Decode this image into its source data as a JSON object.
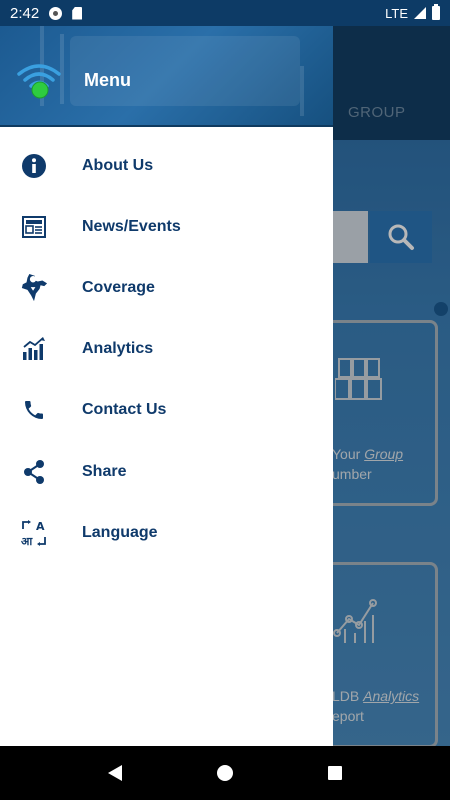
{
  "status_bar": {
    "time": "2:42",
    "network": "LTE",
    "icons": [
      "gear-icon",
      "sd-card-icon",
      "signal-icon",
      "battery-icon"
    ]
  },
  "background": {
    "tab_label": "GROUP",
    "card1_line1_prefix": "Your ",
    "card1_line1_em": "Group",
    "card1_line2": "umber",
    "card2_line1_prefix": "LDB ",
    "card2_line1_em": "Analytics",
    "card2_line2": "eport"
  },
  "drawer": {
    "title": "Menu",
    "items": [
      {
        "label": "About Us",
        "icon": "info-icon"
      },
      {
        "label": "News/Events",
        "icon": "newspaper-icon"
      },
      {
        "label": "Coverage",
        "icon": "india-map-icon"
      },
      {
        "label": "Analytics",
        "icon": "bar-chart-icon"
      },
      {
        "label": "Contact Us",
        "icon": "phone-icon"
      },
      {
        "label": "Share",
        "icon": "share-icon"
      },
      {
        "label": "Language",
        "icon": "translate-icon"
      }
    ]
  },
  "colors": {
    "primary": "#0f3a6b",
    "header": "#1c5a91",
    "accent_green": "#2ecc40",
    "wifi_blue": "#3aa0e0"
  },
  "nav": {
    "buttons": [
      "back-icon",
      "home-icon",
      "recents-icon"
    ]
  }
}
